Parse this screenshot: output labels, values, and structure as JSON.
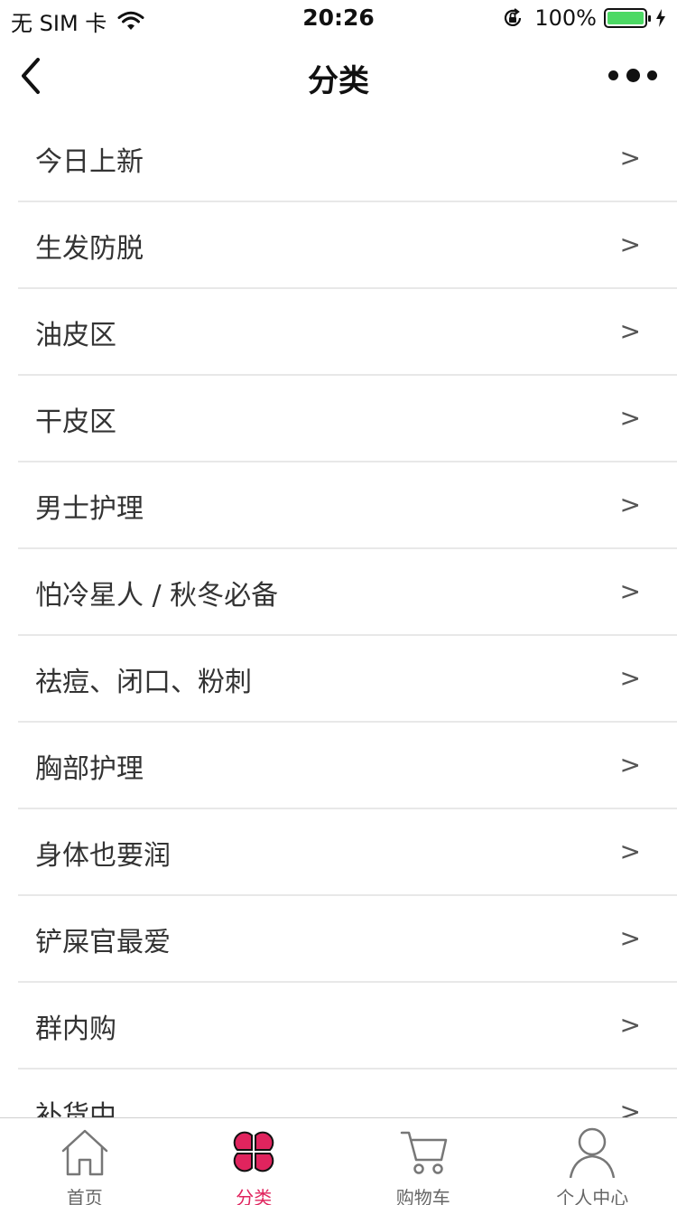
{
  "status_bar": {
    "carrier": "无 SIM 卡",
    "time": "20:26",
    "battery_percent": "100%"
  },
  "nav": {
    "title": "分类"
  },
  "categories": [
    {
      "label": "今日上新",
      "chevron": ">"
    },
    {
      "label": "生发防脱",
      "chevron": ">"
    },
    {
      "label": "油皮区",
      "chevron": ">"
    },
    {
      "label": "干皮区",
      "chevron": ">"
    },
    {
      "label": "男士护理",
      "chevron": ">"
    },
    {
      "label": "怕冷星人 / 秋冬必备",
      "chevron": ">"
    },
    {
      "label": "祛痘、闭口、粉刺",
      "chevron": ">"
    },
    {
      "label": "胸部护理",
      "chevron": ">"
    },
    {
      "label": "身体也要润",
      "chevron": ">"
    },
    {
      "label": "铲屎官最爱",
      "chevron": ">"
    },
    {
      "label": "群内购",
      "chevron": ">"
    },
    {
      "label": "补货中",
      "chevron": ">"
    }
  ],
  "tab_bar": {
    "tabs": [
      {
        "label": "首页",
        "icon": "home-icon",
        "active": false
      },
      {
        "label": "分类",
        "icon": "clover-icon",
        "active": true
      },
      {
        "label": "购物车",
        "icon": "cart-icon",
        "active": false
      },
      {
        "label": "个人中心",
        "icon": "user-icon",
        "active": false
      }
    ]
  },
  "colors": {
    "accent": "#e0245e",
    "battery": "#4cd964",
    "divider": "#e8e8e8"
  }
}
